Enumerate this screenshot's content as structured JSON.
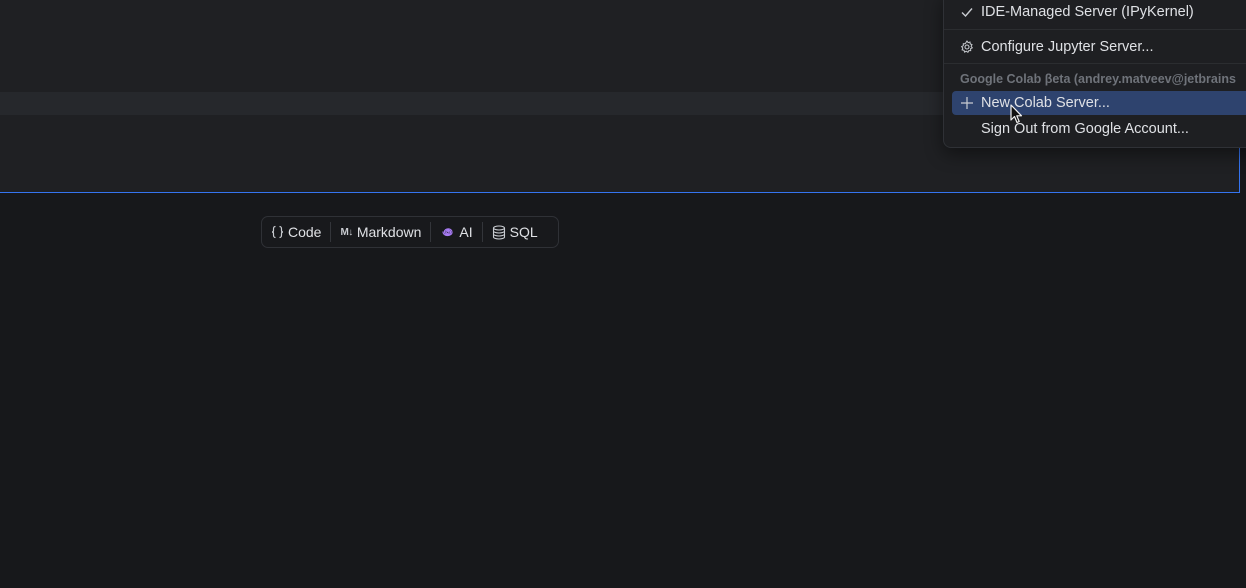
{
  "toolbar": {
    "code_label": "Code",
    "markdown_icon_text": "M↓",
    "markdown_label": "Markdown",
    "ai_label": "AI",
    "sql_label": "SQL"
  },
  "popup": {
    "ide_managed_label": "IDE-Managed Server (IPyKernel)",
    "configure_label": "Configure Jupyter Server...",
    "colab_header": "Google Colab βeta (andrey.matveev@jetbrains",
    "new_colab_label": "New Colab Server...",
    "sign_out_label": "Sign Out from Google Account..."
  },
  "colors": {
    "background": "#17181b",
    "selection_border": "#3574f0",
    "selected_item": "#2e436e",
    "ai_accent": "#a77bf3"
  }
}
